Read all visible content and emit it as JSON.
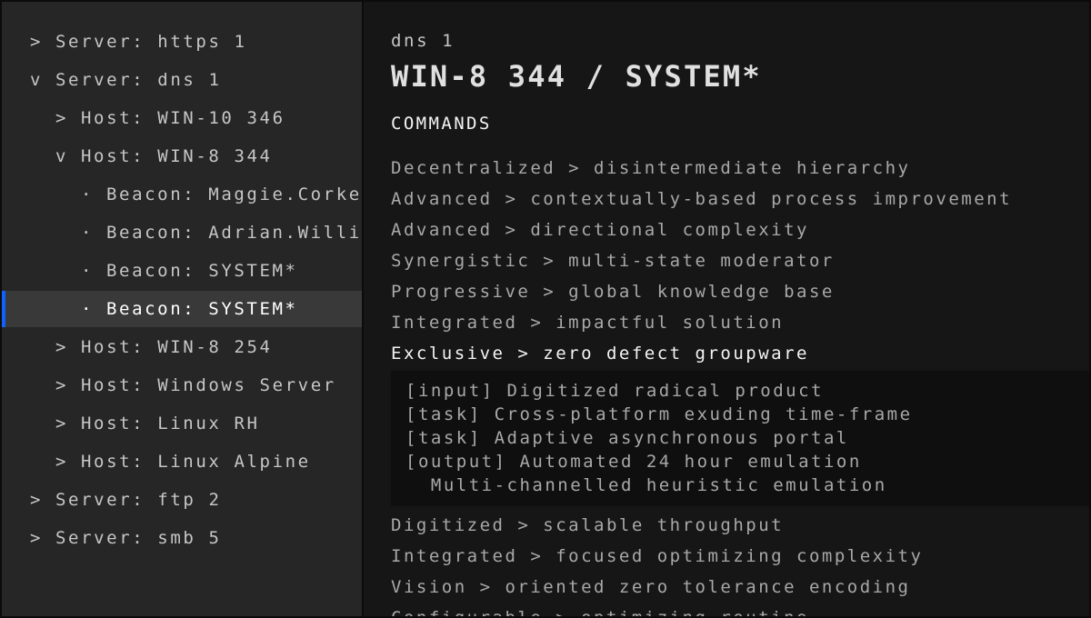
{
  "sidebar": {
    "items": [
      {
        "level": 0,
        "marker": ">",
        "label": "Server: https 1",
        "selected": false
      },
      {
        "level": 0,
        "marker": "v",
        "label": "Server: dns 1",
        "selected": false
      },
      {
        "level": 1,
        "marker": ">",
        "label": "Host: WIN-10 346",
        "selected": false
      },
      {
        "level": 1,
        "marker": "v",
        "label": "Host: WIN-8 344",
        "selected": false
      },
      {
        "level": 2,
        "marker": "·",
        "label": "Beacon: Maggie.Corker",
        "selected": false
      },
      {
        "level": 2,
        "marker": "·",
        "label": "Beacon: Adrian.Williams",
        "selected": false
      },
      {
        "level": 2,
        "marker": "·",
        "label": "Beacon: SYSTEM*",
        "selected": false
      },
      {
        "level": 2,
        "marker": "·",
        "label": "Beacon: SYSTEM*",
        "selected": true
      },
      {
        "level": 1,
        "marker": ">",
        "label": "Host: WIN-8 254",
        "selected": false
      },
      {
        "level": 1,
        "marker": ">",
        "label": "Host: Windows Server",
        "selected": false
      },
      {
        "level": 1,
        "marker": ">",
        "label": "Host: Linux RH",
        "selected": false
      },
      {
        "level": 1,
        "marker": ">",
        "label": "Host: Linux Alpine",
        "selected": false
      },
      {
        "level": 0,
        "marker": ">",
        "label": "Server: ftp 2",
        "selected": false
      },
      {
        "level": 0,
        "marker": ">",
        "label": "Server: smb 5",
        "selected": false
      }
    ]
  },
  "main": {
    "breadcrumb": "dns 1",
    "title": "WIN-8 344 / SYSTEM*",
    "section_heading": "COMMANDS",
    "commands_before": [
      "Decentralized > disintermediate hierarchy",
      "Advanced > contextually-based process improvement",
      "Advanced > directional complexity",
      "Synergistic > multi-state moderator",
      "Progressive > global knowledge base",
      "Integrated > impactful solution"
    ],
    "active_command": "Exclusive > zero defect groupware",
    "output_lines": [
      "[input] Digitized radical product",
      "[task] Cross-platform exuding time-frame",
      "[task] Adaptive asynchronous portal",
      "[output] Automated 24 hour emulation",
      "  Multi-channelled heuristic emulation"
    ],
    "commands_after": [
      "Digitized > scalable throughput",
      "Integrated > focused optimizing complexity",
      "Vision > oriented zero tolerance encoding",
      "Configurable > optimizing routine"
    ]
  },
  "colors": {
    "selection_accent": "#0f62fe",
    "sidebar_bg": "#262626",
    "main_bg": "#161616",
    "output_bg": "#0f0f0f"
  }
}
